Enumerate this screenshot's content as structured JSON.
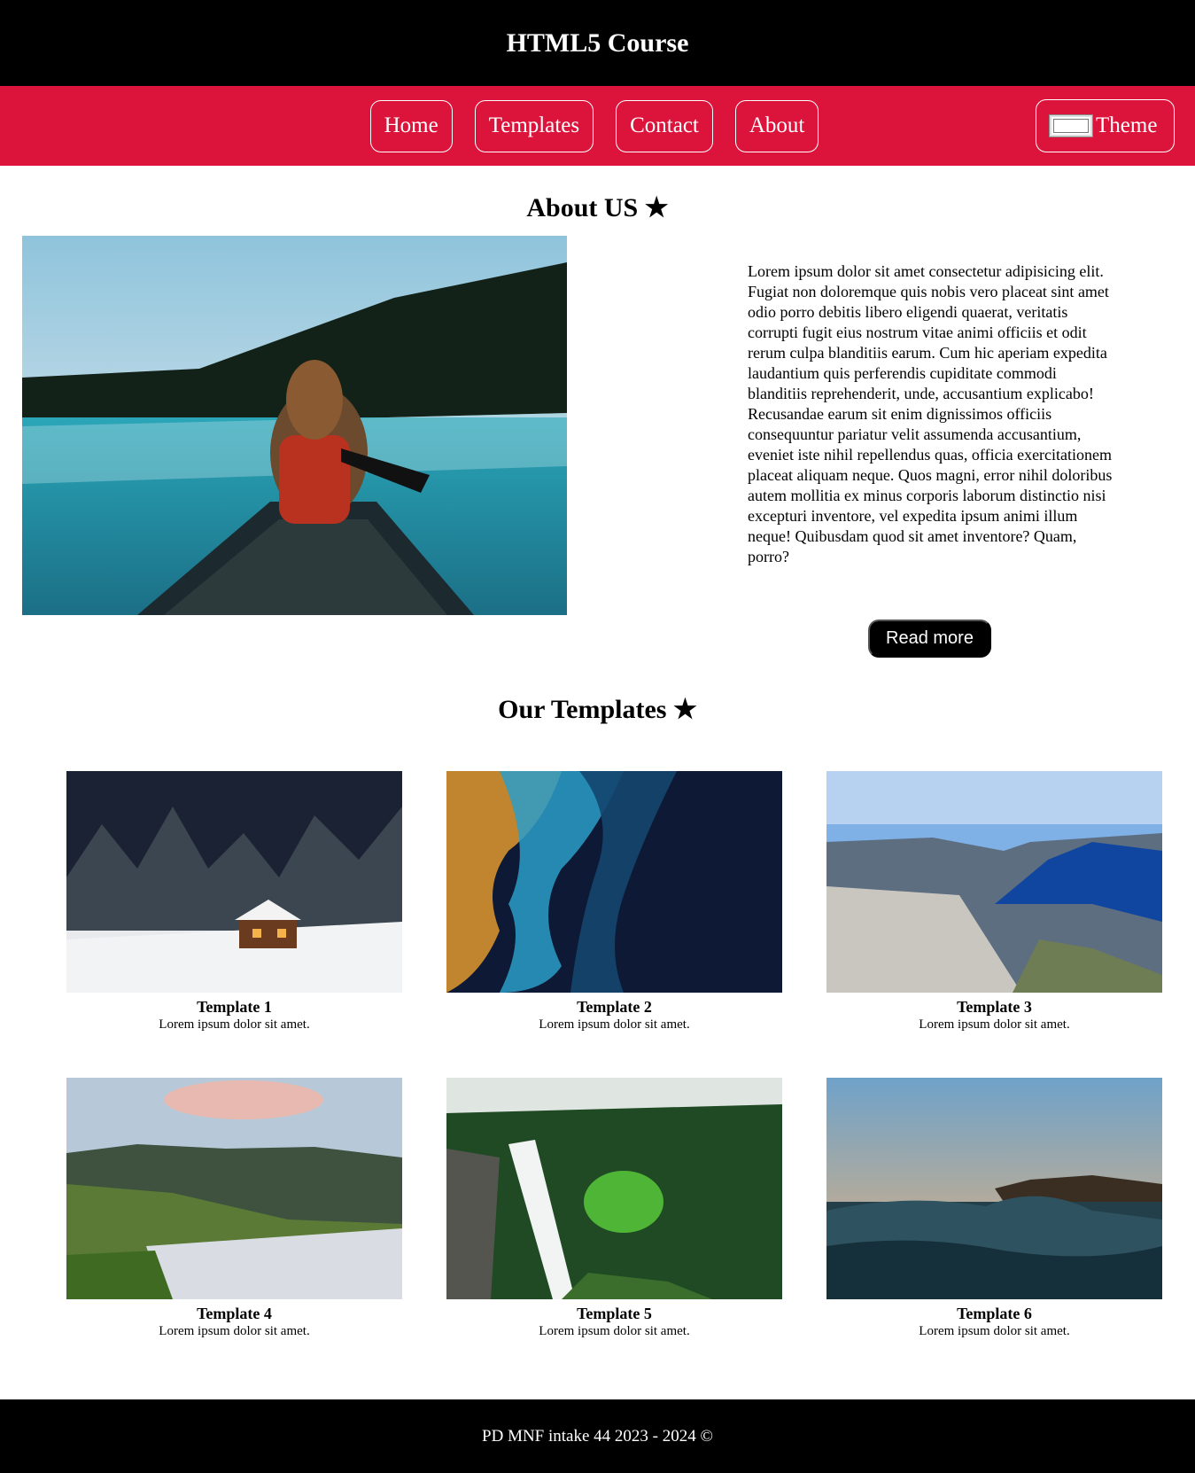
{
  "header": {
    "title": "HTML5 Course"
  },
  "nav": {
    "items": [
      {
        "label": "Home"
      },
      {
        "label": "Templates"
      },
      {
        "label": "Contact"
      },
      {
        "label": "About"
      }
    ],
    "theme_label": "Theme"
  },
  "about": {
    "title": "About US ★",
    "text": "Lorem ipsum dolor sit amet consectetur adipisicing elit. Fugiat non doloremque quis nobis vero placeat sint amet odio porro debitis libero eligendi quaerat, veritatis corrupti fugit eius nostrum vitae animi officiis et odit rerum culpa blanditiis earum. Cum hic aperiam expedita laudantium quis perferendis cupiditate commodi blanditiis reprehenderit, unde, accusantium explicabo! Recusandae earum sit enim dignissimos officiis consequuntur pariatur velit assumenda accusantium, eveniet iste nihil repellendus quas, officia exercitationem placeat aliquam neque. Quos magni, error nihil doloribus autem mollitia ex minus corporis laborum distinctio nisi excepturi inventore, vel expedita ipsum animi illum neque! Quibusdam quod sit amet inventore? Quam, porro?",
    "button": "Read more"
  },
  "templates": {
    "title": "Our Templates ★",
    "items": [
      {
        "title": "Template 1",
        "desc": "Lorem ipsum dolor sit amet."
      },
      {
        "title": "Template 2",
        "desc": "Lorem ipsum dolor sit amet."
      },
      {
        "title": "Template 3",
        "desc": "Lorem ipsum dolor sit amet."
      },
      {
        "title": "Template 4",
        "desc": "Lorem ipsum dolor sit amet."
      },
      {
        "title": "Template 5",
        "desc": "Lorem ipsum dolor sit amet."
      },
      {
        "title": "Template 6",
        "desc": "Lorem ipsum dolor sit amet."
      }
    ]
  },
  "footer": {
    "text": "PD MNF intake 44 2023 - 2024 ©"
  },
  "colors": {
    "nav_bg": "#dc143c",
    "header_bg": "#000000",
    "footer_bg": "#000000"
  }
}
